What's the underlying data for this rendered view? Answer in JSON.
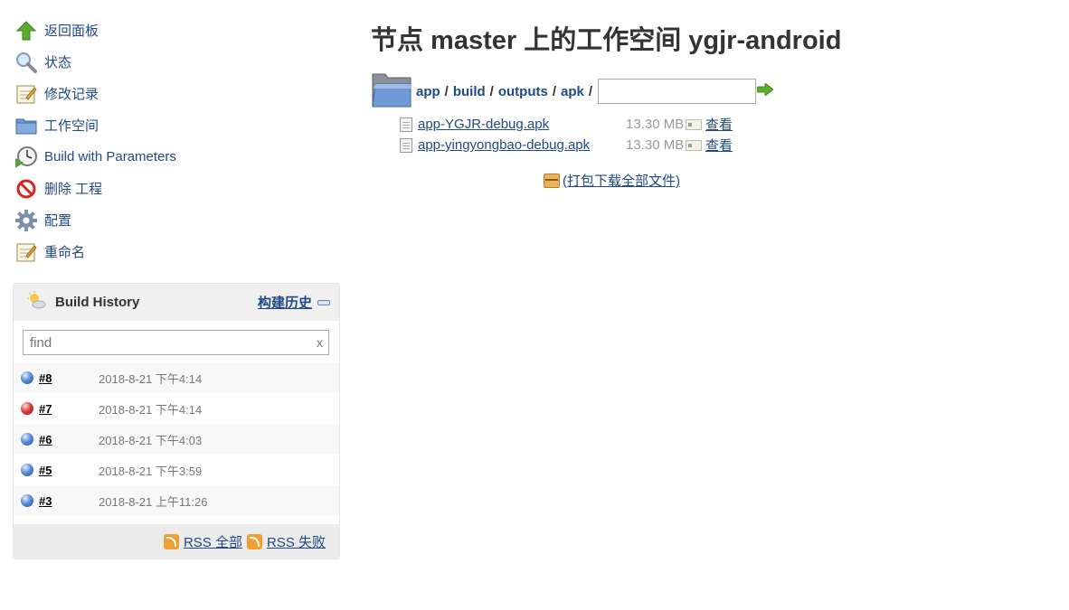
{
  "sidebar": {
    "items": [
      {
        "label": "返回面板",
        "icon": "up-arrow-icon"
      },
      {
        "label": "状态",
        "icon": "magnifier-icon"
      },
      {
        "label": "修改记录",
        "icon": "notepad-icon"
      },
      {
        "label": "工作空间",
        "icon": "folder-icon"
      },
      {
        "label": "Build with Parameters",
        "icon": "clock-play-icon"
      },
      {
        "label": "删除 工程",
        "icon": "no-entry-icon"
      },
      {
        "label": "配置",
        "icon": "gear-icon"
      },
      {
        "label": "重命名",
        "icon": "notepad-icon"
      }
    ]
  },
  "build_history": {
    "title": "Build History",
    "trend_label": "构建历史",
    "search_placeholder": "find",
    "clear_label": "x",
    "builds": [
      {
        "number": "#8",
        "date": "2018-8-21 下午4:14",
        "status": "blue"
      },
      {
        "number": "#7",
        "date": "2018-8-21 下午4:14",
        "status": "red"
      },
      {
        "number": "#6",
        "date": "2018-8-21 下午4:03",
        "status": "blue"
      },
      {
        "number": "#5",
        "date": "2018-8-21 下午3:59",
        "status": "blue"
      },
      {
        "number": "#3",
        "date": "2018-8-21 上午11:26",
        "status": "blue"
      }
    ],
    "rss_all": "RSS 全部",
    "rss_failed": "RSS 失败"
  },
  "main": {
    "title": "节点 master 上的工作空间 ygjr-android",
    "breadcrumb": [
      "app",
      "build",
      "outputs",
      "apk"
    ],
    "separator": "/",
    "files": [
      {
        "name": "app-YGJR-debug.apk",
        "size": "13.30 MB",
        "view": "查看"
      },
      {
        "name": "app-yingyongbao-debug.apk",
        "size": "13.30 MB",
        "view": "查看"
      }
    ],
    "zip_label": "(打包下载全部文件)"
  }
}
